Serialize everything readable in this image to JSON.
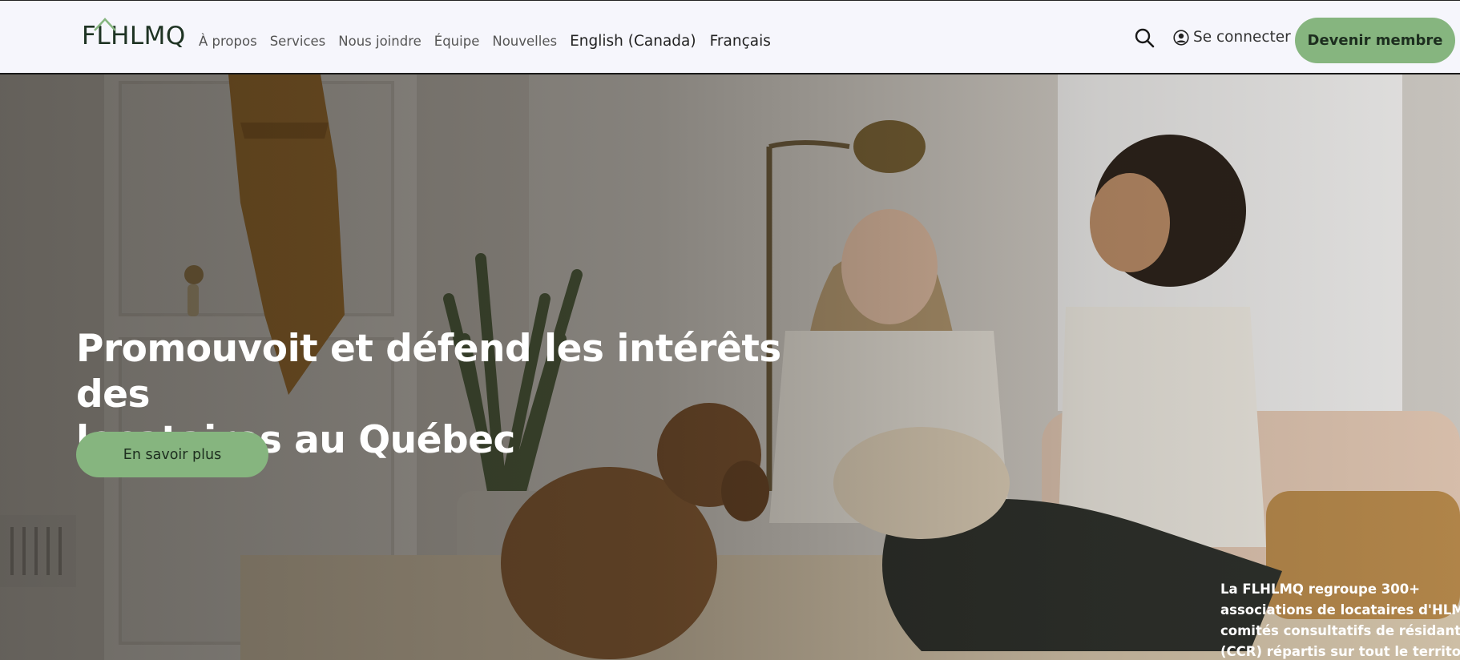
{
  "header": {
    "logo_text": "FLHLMQ",
    "nav": [
      {
        "label": "À propos"
      },
      {
        "label": "Services"
      },
      {
        "label": "Nous joindre"
      },
      {
        "label": "Équipe"
      },
      {
        "label": "Nouvelles"
      }
    ],
    "languages": [
      {
        "label": "English (Canada)"
      },
      {
        "label": "Français"
      }
    ],
    "search_icon": "search-icon",
    "login_label": "Se connecter",
    "login_icon": "user-circle-icon",
    "member_button_label": "Devenir membre"
  },
  "hero": {
    "title_line1": "Promouvoit et défend les intérêts des",
    "title_line2": "locataires au Québec",
    "cta_label": "En savoir plus",
    "description_lines": [
      "La FLHLMQ regroupe 300+",
      "associations de locataires d'HLM et",
      "comités consultatifs de résidant(e)s",
      "(CCR) répartis sur tout le territoire"
    ]
  },
  "colors": {
    "accent": "#86b57f",
    "header_bg": "#f6f6fc",
    "logo": "#1e3323",
    "hero_text": "#ffffff"
  }
}
